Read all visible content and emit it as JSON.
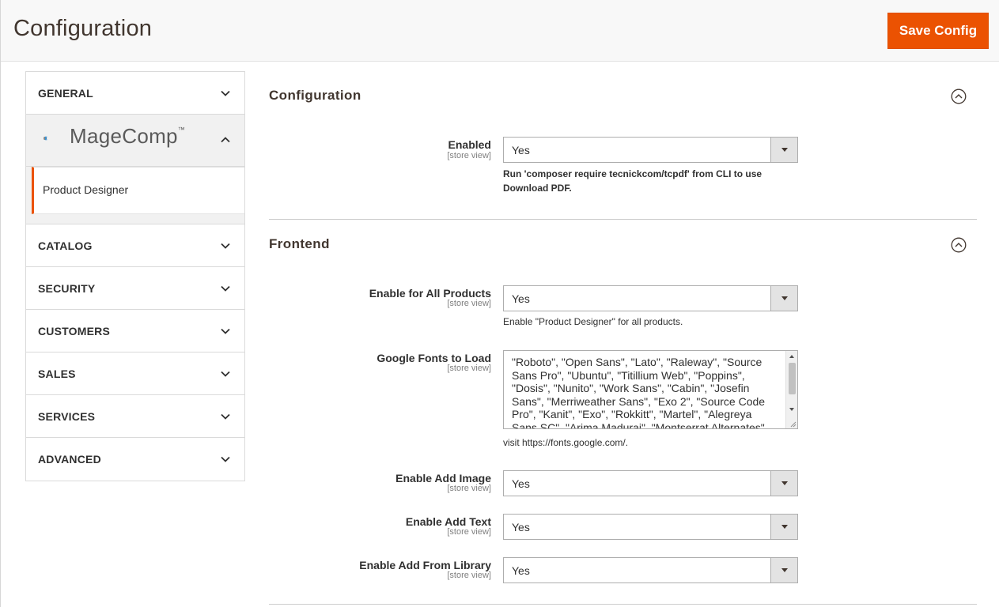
{
  "page": {
    "title": "Configuration",
    "save_label": "Save Config"
  },
  "sidebar": {
    "tabs_top": [
      {
        "label": "GENERAL"
      }
    ],
    "brand": {
      "name": "MageComp",
      "tm": "™",
      "sub_items": [
        {
          "label": "Product Designer"
        }
      ]
    },
    "tabs_bottom": [
      {
        "label": "CATALOG"
      },
      {
        "label": "SECURITY"
      },
      {
        "label": "CUSTOMERS"
      },
      {
        "label": "SALES"
      },
      {
        "label": "SERVICES"
      },
      {
        "label": "ADVANCED"
      }
    ]
  },
  "sections": {
    "configuration": {
      "title": "Configuration",
      "fields": {
        "enabled": {
          "label": "Enabled",
          "scope": "[store view]",
          "value": "Yes",
          "note": "Run 'composer require tecnickcom/tcpdf' from CLI to use Download PDF."
        }
      }
    },
    "frontend": {
      "title": "Frontend",
      "fields": {
        "enable_all": {
          "label": "Enable for All Products",
          "scope": "[store view]",
          "value": "Yes",
          "note": "Enable \"Product Designer\" for all products."
        },
        "google_fonts": {
          "label": "Google Fonts to Load",
          "scope": "[store view]",
          "value": "\"Roboto\", \"Open Sans\", \"Lato\", \"Raleway\", \"Source Sans Pro\", \"Ubuntu\", \"Titillium Web\", \"Poppins\", \"Dosis\", \"Nunito\", \"Work Sans\", \"Cabin\", \"Josefin Sans\", \"Merriweather Sans\", \"Exo 2\", \"Source Code Pro\", \"Kanit\", \"Exo\", \"Rokkitt\", \"Martel\", \"Alegreya Sans SC\", \"Arima Madurai\", \"Montserrat Alternates\"",
          "note": "visit https://fonts.google.com/."
        },
        "add_image": {
          "label": "Enable Add Image",
          "scope": "[store view]",
          "value": "Yes"
        },
        "add_text": {
          "label": "Enable Add Text",
          "scope": "[store view]",
          "value": "Yes"
        },
        "add_library": {
          "label": "Enable Add From Library",
          "scope": "[store view]",
          "value": "Yes"
        }
      }
    }
  },
  "colors": {
    "accent": "#eb5202",
    "title": "#41362f",
    "text": "#303030",
    "scope": "#808080"
  },
  "icons": {
    "tab_chevron": "chevron-down-icon",
    "brand_chevron": "chevron-up-icon",
    "section_toggle": "collapse-circle-icon"
  }
}
